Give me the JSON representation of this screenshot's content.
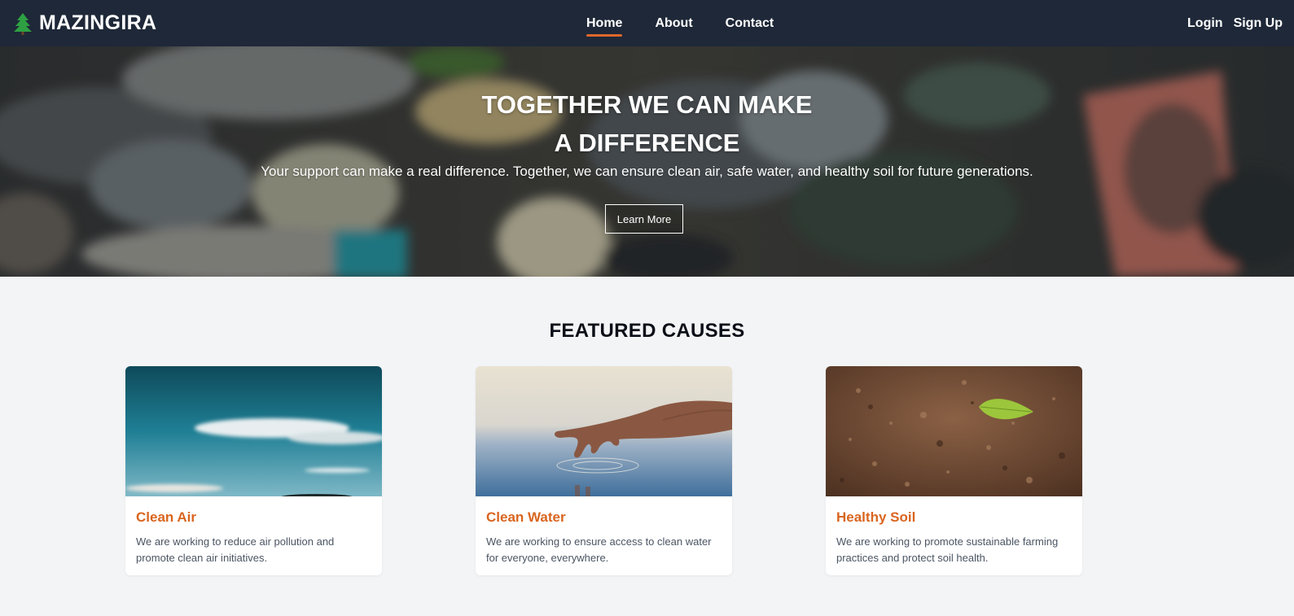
{
  "brand": {
    "name": "MAZINGIRA",
    "icon": "tree-icon",
    "icon_color": "#2ea043"
  },
  "nav": {
    "links": [
      {
        "label": "Home",
        "active": true
      },
      {
        "label": "About",
        "active": false
      },
      {
        "label": "Contact",
        "active": false
      }
    ],
    "login_label": "Login",
    "signup_label": "Sign Up"
  },
  "hero": {
    "title_line1": "TOGETHER WE CAN MAKE",
    "title_line2": "A DIFFERENCE",
    "subtitle": "Your support can make a real difference. Together, we can ensure clean air, safe water, and healthy soil for future generations.",
    "button_label": "Learn More"
  },
  "featured": {
    "title": "FEATURED CAUSES",
    "cards": [
      {
        "title": "Clean Air",
        "text": "We are working to reduce air pollution and promote clean air initiatives.",
        "image": "sky-clouds-image"
      },
      {
        "title": "Clean Water",
        "text": "We are working to ensure access to clean water for everyone, everywhere.",
        "image": "hand-water-image"
      },
      {
        "title": "Healthy Soil",
        "text": "We are working to promote sustainable farming practices and protect soil health.",
        "image": "soil-leaf-image"
      }
    ]
  },
  "colors": {
    "navbar_bg": "#1e2838",
    "accent": "#e0672b",
    "card_title": "#d9651f",
    "page_bg": "#f3f4f6"
  }
}
